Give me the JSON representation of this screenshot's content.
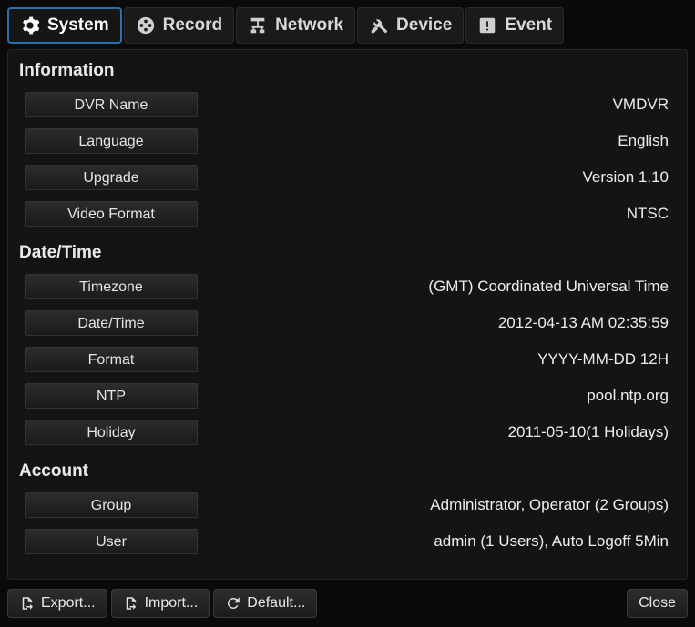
{
  "tabs": {
    "system": {
      "label": "System"
    },
    "record": {
      "label": "Record"
    },
    "network": {
      "label": "Network"
    },
    "device": {
      "label": "Device"
    },
    "event": {
      "label": "Event"
    }
  },
  "sections": {
    "information": {
      "title": "Information",
      "dvr_name": {
        "label": "DVR Name",
        "value": "VMDVR"
      },
      "language": {
        "label": "Language",
        "value": "English"
      },
      "upgrade": {
        "label": "Upgrade",
        "value": "Version 1.10"
      },
      "video_format": {
        "label": "Video Format",
        "value": "NTSC"
      }
    },
    "datetime": {
      "title": "Date/Time",
      "timezone": {
        "label": "Timezone",
        "value": "(GMT) Coordinated Universal Time"
      },
      "datetime": {
        "label": "Date/Time",
        "value": "2012-04-13 AM 02:35:59"
      },
      "format": {
        "label": "Format",
        "value": "YYYY-MM-DD 12H"
      },
      "ntp": {
        "label": "NTP",
        "value": "pool.ntp.org"
      },
      "holiday": {
        "label": "Holiday",
        "value": "2011-05-10(1 Holidays)"
      }
    },
    "account": {
      "title": "Account",
      "group": {
        "label": "Group",
        "value": "Administrator, Operator (2 Groups)"
      },
      "user": {
        "label": "User",
        "value": "admin (1 Users), Auto Logoff 5Min"
      }
    }
  },
  "footer": {
    "export": "Export...",
    "import": "Import...",
    "default": "Default...",
    "close": "Close"
  }
}
